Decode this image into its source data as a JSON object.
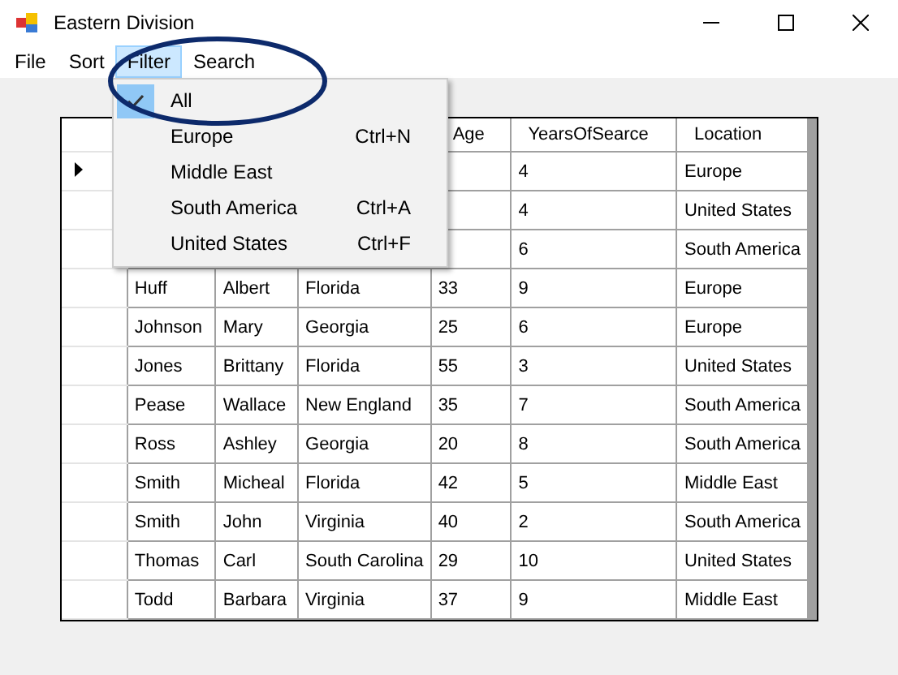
{
  "window": {
    "title": "Eastern Division"
  },
  "menu_bar": [
    {
      "label": "File",
      "selected": false
    },
    {
      "label": "Sort",
      "selected": false
    },
    {
      "label": "Filter",
      "selected": true
    },
    {
      "label": "Search",
      "selected": false
    }
  ],
  "filter_menu": [
    {
      "label": "All",
      "checked": true
    },
    {
      "label": "Europe",
      "shortcut": "Ctrl+N",
      "checked": false
    },
    {
      "label": "Middle East",
      "checked": false
    },
    {
      "label": "South America",
      "shortcut": "Ctrl+A",
      "checked": false
    },
    {
      "label": "United States",
      "shortcut": "Ctrl+F",
      "checked": false
    }
  ],
  "table": {
    "header": {
      "age": "Age",
      "years": "YearsOfSearce",
      "location": "Location"
    },
    "rows": [
      {
        "selected": true,
        "years": "4",
        "location": "Europe"
      },
      {
        "selected": false,
        "years": "4",
        "location": "United States"
      },
      {
        "selected": false,
        "years": "6",
        "location": "South America"
      },
      {
        "selected": false,
        "last": "Huff",
        "first": "Albert",
        "state": "Florida",
        "age": "33",
        "years": "9",
        "location": "Europe"
      },
      {
        "selected": false,
        "last": "Johnson",
        "first": "Mary",
        "state": "Georgia",
        "age": "25",
        "years": "6",
        "location": "Europe"
      },
      {
        "selected": false,
        "last": "Jones",
        "first": "Brittany",
        "state": "Florida",
        "age": "55",
        "years": "3",
        "location": "United States"
      },
      {
        "selected": false,
        "last": "Pease",
        "first": "Wallace",
        "state": "New England",
        "age": "35",
        "years": "7",
        "location": "South America"
      },
      {
        "selected": false,
        "last": "Ross",
        "first": "Ashley",
        "state": "Georgia",
        "age": "20",
        "years": "8",
        "location": "South America"
      },
      {
        "selected": false,
        "last": "Smith",
        "first": "Micheal",
        "state": "Florida",
        "age": "42",
        "years": "5",
        "location": "Middle East"
      },
      {
        "selected": false,
        "last": "Smith",
        "first": "John",
        "state": "Virginia",
        "age": "40",
        "years": "2",
        "location": "South America"
      },
      {
        "selected": false,
        "last": "Thomas",
        "first": "Carl",
        "state": "South Carolina",
        "age": "29",
        "years": "10",
        "location": "United States"
      },
      {
        "selected": false,
        "last": "Todd",
        "first": "Barbara",
        "state": "Virginia",
        "age": "37",
        "years": "9",
        "location": "Middle East"
      }
    ]
  }
}
